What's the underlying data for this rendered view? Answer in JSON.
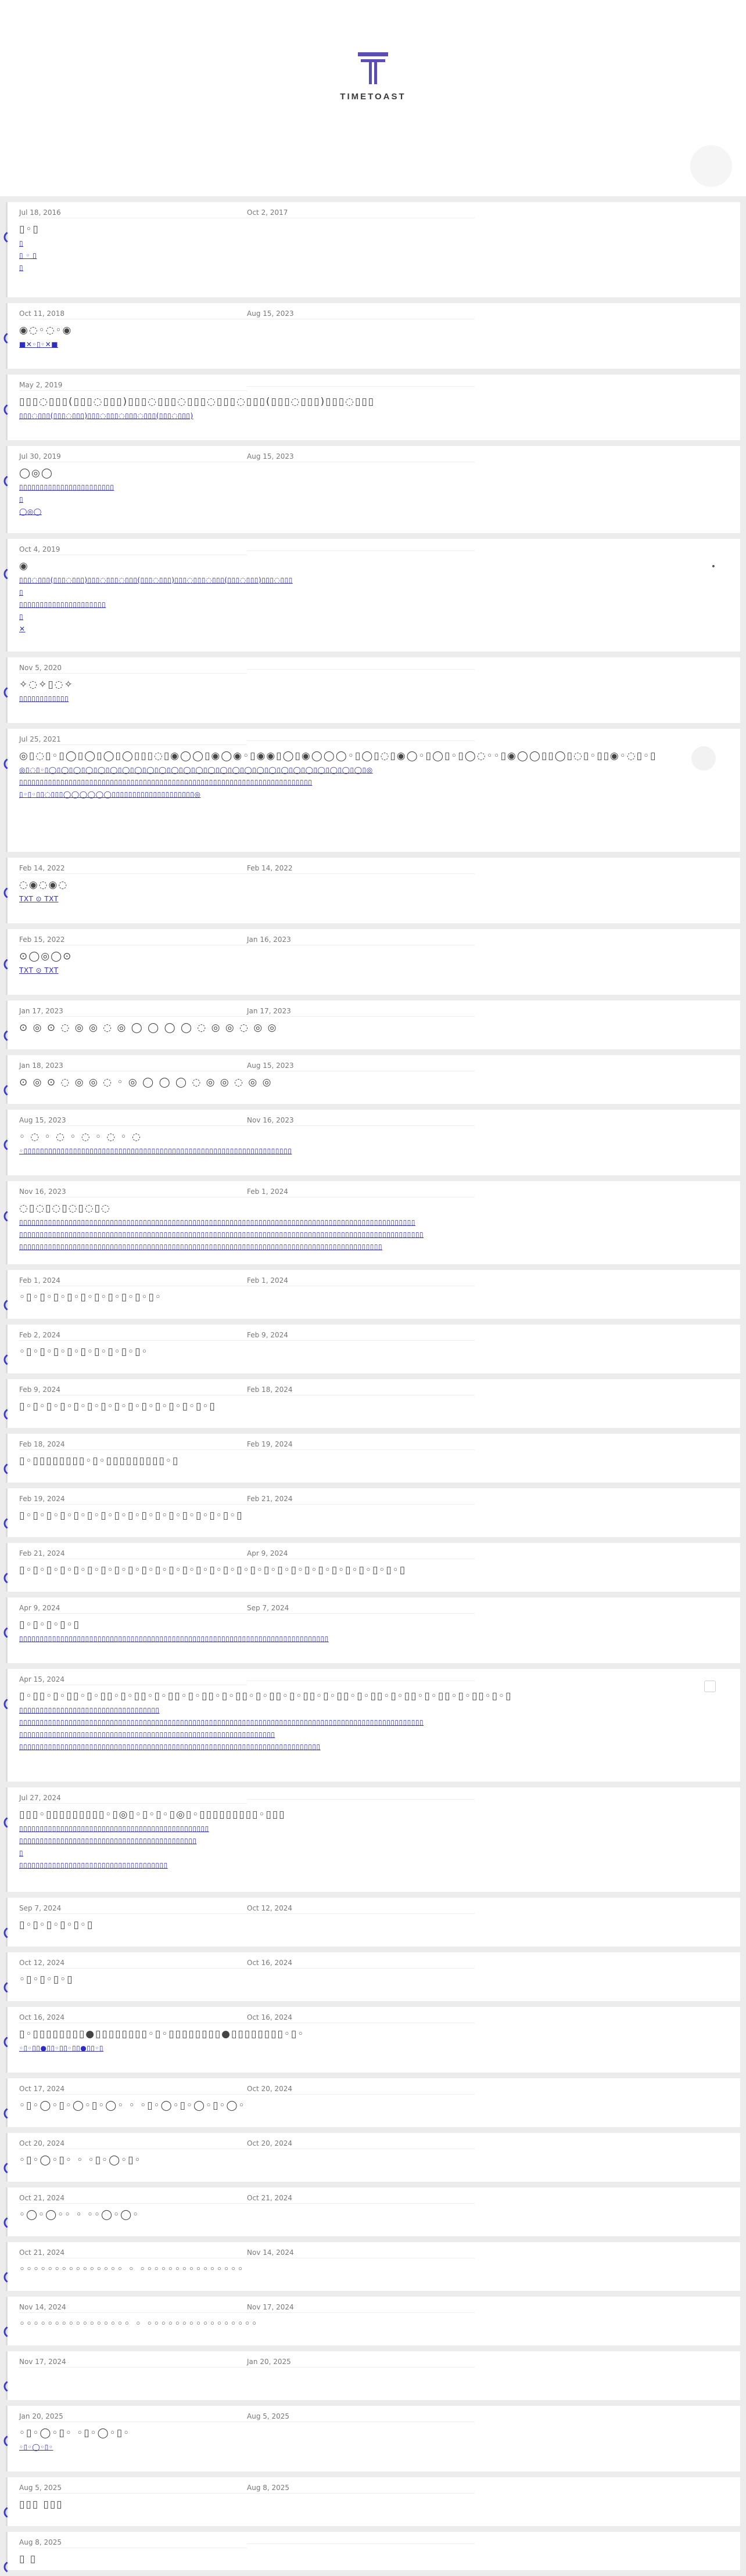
{
  "header": {
    "brand": "TIMETOAST"
  },
  "events": [
    {
      "start": "Jul 18, 2016",
      "end": "Oct 2, 2017",
      "title": "▯◦▯",
      "desc": [
        "    ▯",
        "▯ ◦ ▯",
        "   ▯"
      ],
      "mh": 164
    },
    {
      "start": "Oct 11, 2018",
      "end": "Aug 15, 2023",
      "title": "◉◌◦◌◦◉",
      "desc": [
        "■✕◦▯◦✕■"
      ],
      "mh": 113
    },
    {
      "start": "May 2, 2019",
      "end": "",
      "title": "▯▯▯◌▯▯▯(▯▯▯◌▯▯▯)▯▯▯◌▯▯▯◌▯▯▯◌▯▯▯◌▯▯▯(▯▯▯◌▯▯▯)▯▯▯◌▯▯▯",
      "desc": [
        "▯▯▯◌▯▯▯(▯▯▯◌▯▯▯)▯▯▯◌▯▯▯◌▯▯▯◌▯▯▯(▯▯▯◌▯▯▯)"
      ],
      "mh": 113
    },
    {
      "start": "Jul 30, 2019",
      "end": "Aug 15, 2023",
      "title": "◯◎◯",
      "desc": [
        "▯▯▯▯▯▯▯▯▯▯▯▯▯▯▯▯▯▯▯▯▯▯▯",
        "▯",
        "◯◎◯"
      ],
      "mh": 150
    },
    {
      "start": "Oct 4, 2019",
      "end": "",
      "title": "◉",
      "desc": [
        "▯▯▯◌▯▯▯(▯▯▯◌▯▯▯)▯▯▯◌▯▯▯◌▯▯▯(▯▯▯◌▯▯▯)▯▯▯◌▯▯▯◌▯▯▯(▯▯▯◌▯▯▯)▯▯▯◌▯▯▯",
        "▯",
        "▯▯▯▯▯▯▯▯▯▯▯▯▯▯▯▯▯▯▯▯▯",
        "▯",
        "✕"
      ],
      "mh": 194,
      "dot": "•"
    },
    {
      "start": "Nov 5, 2020",
      "end": "",
      "title": "✧◌✧▯◌✧",
      "desc": [
        "▯▯▯▯▯▯▯▯▯▯▯▯"
      ],
      "mh": 113
    },
    {
      "start": "Jul 25, 2021",
      "end": "",
      "title": "◎▯◌▯◦▯◯▯◯▯◯▯◯▯▯▯◌▯◉◯◯▯◉◯◉◦▯◉◉▯◯▯◉◯◯◯◦▯◯▯◌▯◉◯◦▯◯▯◦▯◯◌◦◦▯◉◯◯▯▯◯▯◌▯◦▯▯◉◦◌▯◦▯",
      "desc": [
        "◎▯◌▯◦▯◯▯◯▯◯▯◯▯◯▯◯▯◯▯◯▯◯▯◯▯◯▯◯▯◯▯◯▯◯▯◯▯◯▯◯▯◯▯◯▯◯▯◯▯◯▯◯▯◯▯◯▯◎",
        "▯▯▯▯▯▯▯▯▯▯▯▯▯▯▯▯▯▯▯▯▯▯▯▯▯▯▯▯▯▯▯▯▯▯▯▯▯▯▯▯▯▯▯▯▯▯▯▯▯▯▯▯▯▯▯▯▯▯▯▯▯▯▯▯▯▯▯▯▯▯▯",
        "▯◦▯◦▯▯◌▯▯▯◯◯◯◯◯◯▯▯▯▯▯▯▯▯▯▯▯▯▯▯▯▯▯▯▯▯◎"
      ],
      "mh": 212,
      "mark": true
    },
    {
      "start": "Feb 14, 2022",
      "end": "Feb 14, 2022",
      "title": "◌◉◌◉◌",
      "desc": [
        "TXT                 ⊙                    TXT"
      ],
      "mh": 113
    },
    {
      "start": "Feb 15, 2022",
      "end": "Jan 16, 2023",
      "title": "⊙◯◎◯⊙",
      "desc": [
        "TXT                 ⊙                    TXT"
      ],
      "mh": 113
    },
    {
      "start": "Jan 17, 2023",
      "end": "Jan 17, 2023",
      "title": "⊙ ◎ ⊙ ◌ ◎ ◎ ◌ ◎ ◯ ◯ ◯ ◯ ◌ ◎ ◎ ◌ ◎ ◎",
      "desc": [],
      "mh": 84
    },
    {
      "start": "Jan 18, 2023",
      "end": "Aug 15, 2023",
      "title": "⊙ ◎ ⊙ ◌ ◎ ◎ ◌ ◦ ◎ ◯ ◯ ◯ ◌ ◎ ◎ ◌ ◎ ◎",
      "desc": [],
      "mh": 84
    },
    {
      "start": "Aug 15, 2023",
      "end": "Nov 16, 2023",
      "title": "◦ ◌ ◦ ◌ ◦ ◌ ◦ ◌ ◦ ◌",
      "desc": [
        "◦▯▯▯▯▯▯▯▯▯▯▯▯▯▯▯▯▯▯▯▯▯▯▯▯▯▯▯▯▯▯▯▯▯▯▯▯▯▯▯▯▯▯▯▯▯▯▯▯▯▯▯▯▯▯▯▯▯▯▯▯▯▯▯▯▯"
      ],
      "mh": 113
    },
    {
      "start": "Nov 16, 2023",
      "end": "Feb 1, 2024",
      "title": "◌▯◌▯◌▯◌▯◌▯◌",
      "desc": [
        "▯▯▯▯▯▯▯▯▯▯▯▯▯▯▯▯▯▯▯▯▯▯▯▯▯▯▯▯▯▯▯▯▯▯▯▯▯▯▯▯▯▯▯▯▯▯▯▯▯▯▯▯▯▯▯▯▯▯▯▯▯▯▯▯▯▯▯▯▯▯▯▯▯▯▯▯▯▯▯▯▯▯▯▯▯▯▯▯▯▯▯▯▯▯▯▯",
        "▯▯▯▯▯▯▯▯▯▯▯▯▯▯▯▯▯▯▯▯▯▯▯▯▯▯▯▯▯▯▯▯▯▯▯▯▯▯▯▯▯▯▯▯▯▯▯▯▯▯▯▯▯▯▯▯▯▯▯▯▯▯▯▯▯▯▯▯▯▯▯▯▯▯▯▯▯▯▯▯▯▯▯▯▯▯▯▯▯▯▯▯▯▯▯▯▯▯",
        "▯▯▯▯▯▯▯▯▯▯▯▯▯▯▯▯▯▯▯▯▯▯▯▯▯▯▯▯▯▯▯▯▯▯▯▯▯▯▯▯▯▯▯▯▯▯▯▯▯▯▯▯▯▯▯▯▯▯▯▯▯▯▯▯▯▯▯▯▯▯▯▯▯▯▯▯▯▯▯▯▯▯▯▯▯▯▯▯"
      ],
      "mh": 143
    },
    {
      "start": "Feb 1, 2024",
      "end": "Feb 1, 2024",
      "title": "◦▯◦▯◦▯◦▯◦▯◦▯◦▯◦▯◦▯◦▯◦",
      "desc": [],
      "mh": 84
    },
    {
      "start": "Feb 2, 2024",
      "end": "Feb 9, 2024",
      "title": "◦▯◦▯◦▯◦▯◦▯◦▯◦▯◦▯◦▯◦",
      "desc": [],
      "mh": 84
    },
    {
      "start": "Feb 9, 2024",
      "end": "Feb 18, 2024",
      "title": "▯◦▯◦▯◦▯◦▯◦▯◦▯◦▯◦▯◦▯◦▯◦▯◦▯◦▯◦▯",
      "desc": [],
      "mh": 84
    },
    {
      "start": "Feb 18, 2024",
      "end": "Feb 19, 2024",
      "title": "▯◦▯▯▯▯▯▯▯▯◦▯◦▯▯▯▯▯▯▯▯▯◦▯",
      "desc": [],
      "mh": 84
    },
    {
      "start": "Feb 19, 2024",
      "end": "Feb 21, 2024",
      "title": "▯◦▯◦▯◦▯◦▯◦▯◦▯◦▯◦▯◦▯◦▯◦▯◦▯◦▯◦▯◦▯◦▯",
      "desc": [],
      "mh": 84
    },
    {
      "start": "Feb 21, 2024",
      "end": "Apr 9, 2024",
      "title": "▯◦▯◦▯◦▯◦▯◦▯◦▯◦▯◦▯◦▯◦▯◦▯◦▯◦▯◦▯◦▯◦▯◦▯◦▯◦▯◦▯◦▯◦▯◦▯◦▯◦▯◦▯◦▯◦▯",
      "desc": [],
      "mh": 84
    },
    {
      "start": "Apr 9, 2024",
      "end": "Sep 7, 2024",
      "title": "▯◦▯◦▯◦▯◦▯",
      "desc": [
        "▯▯▯▯▯▯▯▯▯▯▯▯▯▯▯▯▯▯▯▯▯▯▯▯▯▯▯▯▯▯▯▯▯▯▯▯▯▯▯▯▯▯▯▯▯▯▯▯▯▯▯▯▯▯▯▯▯▯▯▯▯▯▯▯▯▯▯▯▯▯▯▯▯▯▯"
      ],
      "mh": 113
    },
    {
      "start": "Apr 15, 2024",
      "end": "",
      "title": "▯◦▯▯◦▯◦▯▯◦▯◦▯▯◦▯◦▯▯◦▯◦▯▯◦▯◦▯▯◦▯◦▯▯◦▯◦▯▯◦▯◦▯▯◦▯◦▯▯◦▯◦▯▯◦▯◦▯▯◦▯◦▯▯◦▯◦▯▯◦▯◦▯",
      "desc": [
        "▯▯▯▯▯▯▯▯▯▯▯▯▯▯▯▯▯▯▯▯▯▯▯▯▯▯▯▯▯▯▯▯▯▯",
        "▯▯▯▯▯▯▯▯▯▯▯▯▯▯▯▯▯▯▯▯▯▯▯▯▯▯▯▯▯▯▯▯▯▯▯▯▯▯▯▯▯▯▯▯▯▯▯▯▯▯▯▯▯▯▯▯▯▯▯▯▯▯▯▯▯▯▯▯▯▯▯▯▯▯▯▯▯▯▯▯▯▯▯▯▯▯▯▯▯▯▯▯▯▯▯▯▯▯",
        "▯▯▯▯▯▯▯▯▯▯▯▯▯▯▯▯▯▯▯▯▯▯▯▯▯▯▯▯▯▯▯▯▯▯▯▯▯▯▯▯▯▯▯▯▯▯▯▯▯▯▯▯▯▯▯▯▯▯▯▯▯▯",
        "▯▯▯▯▯▯▯▯▯▯▯▯▯▯▯▯▯▯▯▯▯▯▯▯▯▯▯▯▯▯▯▯▯▯▯▯▯▯▯▯▯▯▯▯▯▯▯▯▯▯▯▯▯▯▯▯▯▯▯▯▯▯▯▯▯▯▯▯▯▯▯▯▯"
      ],
      "mh": 194,
      "box": true
    },
    {
      "start": "Jul 27, 2024",
      "end": "",
      "title": "▯▯▯◦▯▯▯▯▯▯▯▯▯◦▯◎▯◦▯◦▯◦▯◎▯◦▯▯▯▯▯▯▯▯▯◦▯▯▯",
      "desc": [
        "▯▯▯▯▯▯▯▯▯▯▯▯▯▯▯▯▯▯▯▯▯▯▯▯▯▯▯▯▯▯▯▯▯▯▯▯▯▯▯▯▯▯▯▯▯▯",
        "▯▯▯▯▯▯▯▯▯▯▯▯▯▯▯▯▯▯▯▯▯▯▯▯▯▯▯▯▯▯▯▯▯▯▯▯▯▯▯▯▯▯▯",
        "▯",
        "▯▯▯▯▯▯▯▯▯▯▯▯▯▯▯▯▯▯▯▯▯▯▯▯▯▯▯▯▯▯▯▯▯▯▯▯"
      ],
      "mh": 180
    },
    {
      "start": "Sep 7, 2024",
      "end": "Oct 12, 2024",
      "title": "▯◦▯◦▯◦▯◦▯◦▯",
      "desc": [],
      "mh": 84
    },
    {
      "start": "Oct 12, 2024",
      "end": "Oct 16, 2024",
      "title": "◦▯◦▯◦▯◦▯",
      "desc": [],
      "mh": 84
    },
    {
      "start": "Oct 16, 2024",
      "end": "Oct 16, 2024",
      "title": "▯◦▯▯▯▯▯▯▯▯●▯▯▯▯▯▯▯▯◦▯◦▯▯▯▯▯▯▯▯●▯▯▯▯▯▯▯▯◦▯◦",
      "desc": [
        "◦▯◦▯▯●▯▯◦▯▯◦▯▯●▯▯◦▯"
      ],
      "mh": 113
    },
    {
      "start": "Oct 17, 2024",
      "end": "Oct 20, 2024",
      "title": "◦▯◦◯◦▯◦◯◦▯◦◯◦      ◦        ◦▯◦◯◦▯◦◯◦▯◦◯◦",
      "desc": [],
      "mh": 84
    },
    {
      "start": "Oct 20, 2024",
      "end": "Oct 20, 2024",
      "title": "◦▯◦◯◦▯◦      ◦      ◦▯◦◯◦▯◦",
      "desc": [],
      "mh": 84
    },
    {
      "start": "Oct 21, 2024",
      "end": "Oct 21, 2024",
      "title": "◦◯◦◯◦◦      ◦      ◦◦◯◦◯◦",
      "desc": [],
      "mh": 84
    },
    {
      "start": "Oct 21, 2024",
      "end": "Nov 14, 2024",
      "title": "◦◦◦◦◦◦◦◦◦◦◦◦◦◦◦      ◦      ◦◦◦◦◦◦◦◦◦◦◦◦◦◦◦",
      "desc": [],
      "mh": 84
    },
    {
      "start": "Nov 14, 2024",
      "end": "Nov 17, 2024",
      "title": "◦◦◦◦◦◦◦◦◦◦◦◦◦◦◦◦      ◦      ◦◦◦◦◦◦◦◦◦◦◦◦◦◦◦◦",
      "desc": [],
      "mh": 84
    },
    {
      "start": "Nov 17, 2024",
      "end": "Jan 20, 2025",
      "title": "",
      "desc": [],
      "mh": 84
    },
    {
      "start": "Jan 20, 2025",
      "end": "Aug 5, 2025",
      "title": "◦▯◦◯◦▯◦             ◦▯◦◯◦▯◦",
      "desc": [
        "◦▯◦◯◦▯◦"
      ],
      "mh": 113
    },
    {
      "start": "Aug 5, 2025",
      "end": "Aug 8, 2025",
      "title": "▯▯▯    ▯▯▯",
      "desc": [],
      "mh": 84
    },
    {
      "start": "Aug 8, 2025",
      "end": "",
      "title": "▯    ▯",
      "desc": [],
      "mh": 60
    }
  ]
}
